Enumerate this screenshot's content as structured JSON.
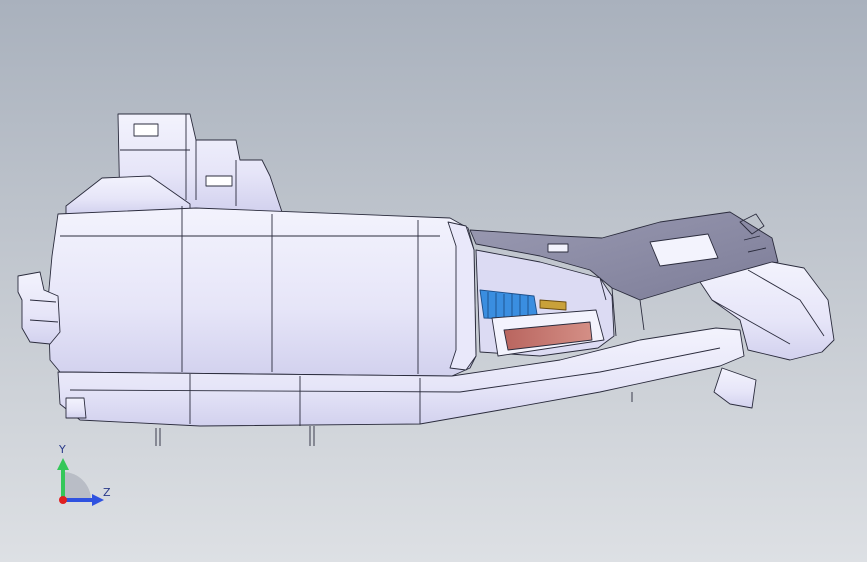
{
  "viewport": {
    "background_top": "#a9b1bd",
    "background_bottom": "#dde0e4"
  },
  "model": {
    "body_color": "#eeeefb",
    "shade_color": "#d4d3ee",
    "edge_color": "#2b2c3d",
    "dark_panel_color": "#8e8ea6",
    "blue_part_color": "#3a8ee0",
    "red_part_color": "#c57a72",
    "gold_part_color": "#c9a13a"
  },
  "triad": {
    "y_label": "Y",
    "z_label": "Z",
    "y_color": "#34c759",
    "z_color": "#2f52e0",
    "origin_color": "#e02020"
  }
}
